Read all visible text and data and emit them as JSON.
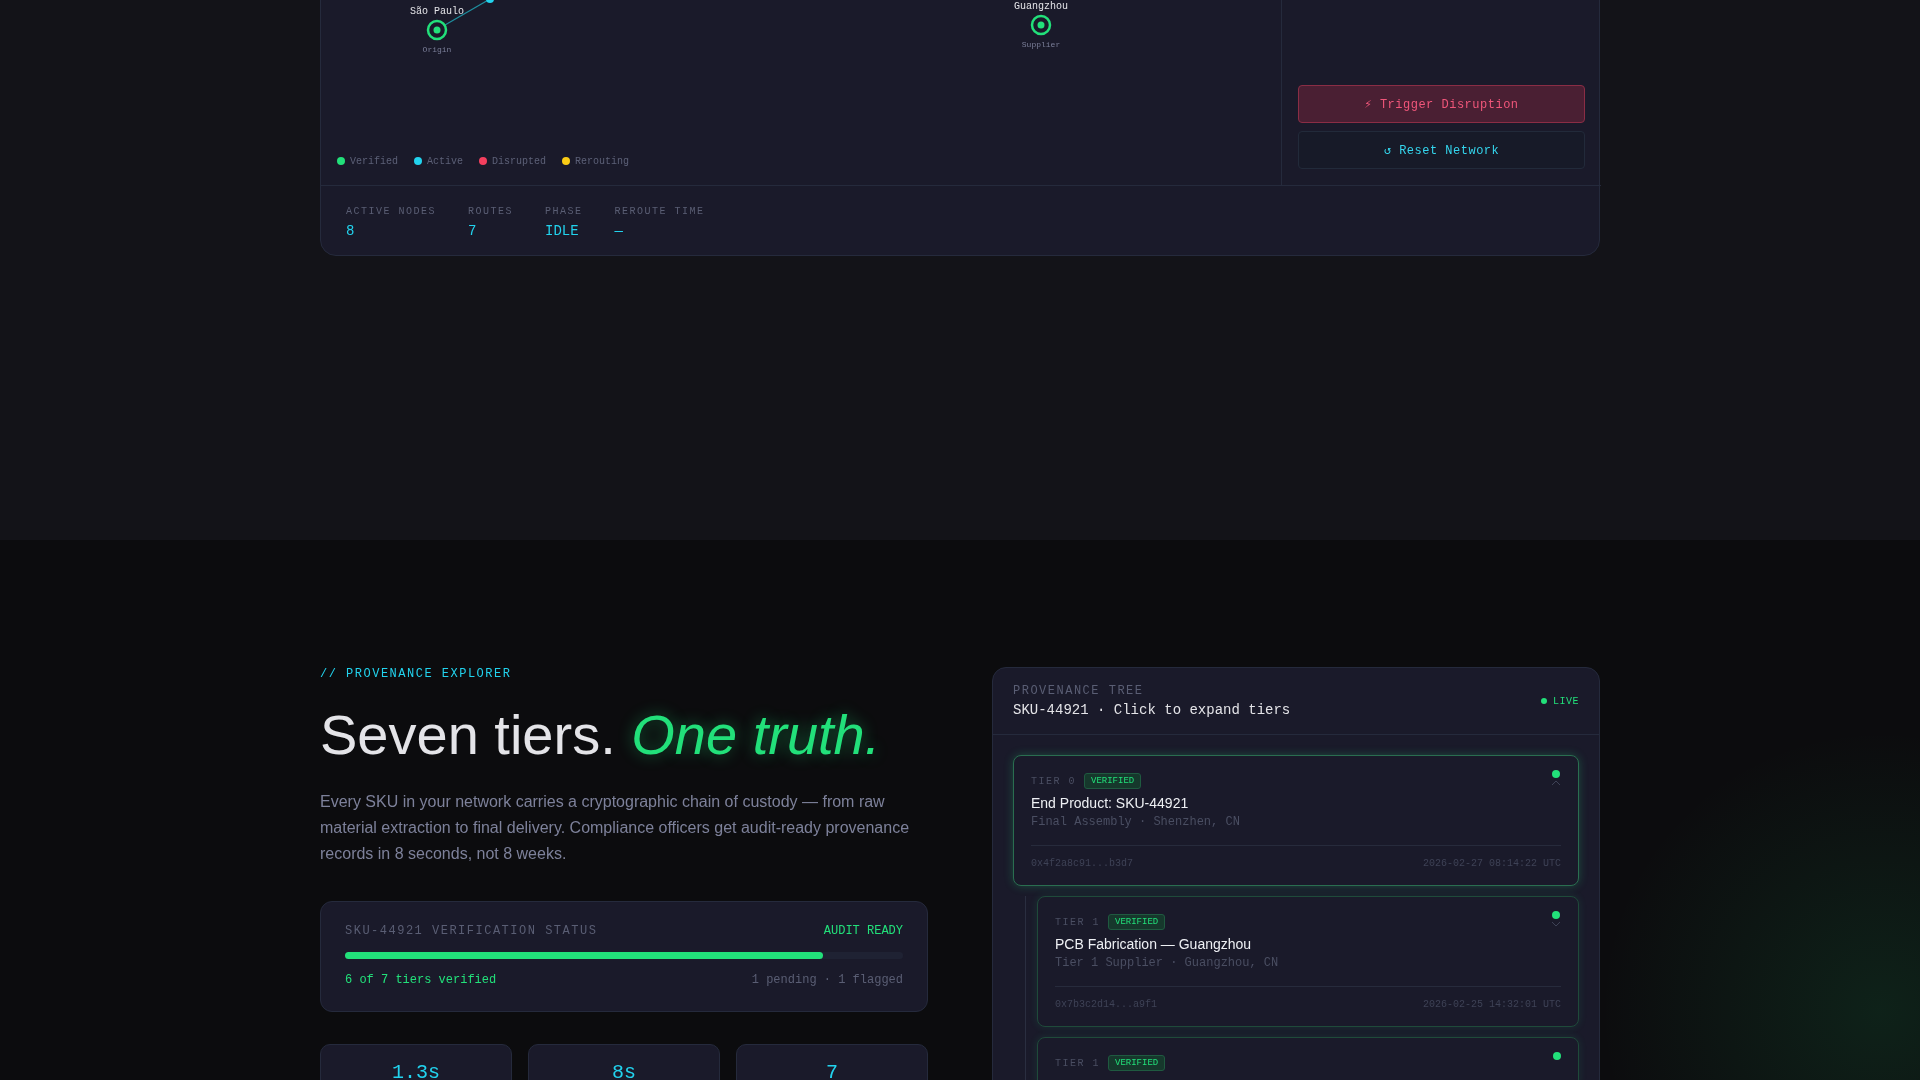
{
  "network": {
    "nodes": [
      {
        "name": "São Paulo",
        "role": "Origin",
        "color": "#22e07a"
      },
      {
        "color": "#22d3ee"
      },
      {
        "name": "Guangzhou",
        "role": "Supplier",
        "color": "#22e07a"
      }
    ],
    "legend": [
      {
        "label": "Verified",
        "color": "#22e07a"
      },
      {
        "label": "Active",
        "color": "#22d3ee"
      },
      {
        "label": "Disrupted",
        "color": "#f43f5e"
      },
      {
        "label": "Rerouting",
        "color": "#facc15"
      }
    ],
    "actions": [
      {
        "kind": "danger",
        "icon": "⚡",
        "label": "Trigger Disruption"
      },
      {
        "kind": "reset",
        "icon": "↺",
        "label": "Reset Network"
      }
    ],
    "stats": [
      {
        "label": "ACTIVE NODES",
        "value": "8"
      },
      {
        "label": "ROUTES",
        "value": "7"
      },
      {
        "label": "PHASE",
        "value": "IDLE"
      },
      {
        "label": "REROUTE TIME",
        "value": "—"
      }
    ]
  },
  "explorer": {
    "eyebrow": "// PROVENANCE EXPLORER",
    "heading": "Seven tiers.",
    "heading_accent": "One truth.",
    "description": "Every SKU in your network carries a cryptographic chain of custody — from raw material extraction to final delivery. Compliance officers get audit-ready provenance records in 8 seconds, not 8 weeks.",
    "status_card": {
      "title": "SKU-44921 VERIFICATION STATUS",
      "badge": "AUDIT READY",
      "level": 0.857,
      "progress_text": "6 of 7 tiers verified",
      "summary": "1 pending · 1 flagged"
    },
    "metrics": [
      {
        "value": "1.3s"
      },
      {
        "value": "8s"
      },
      {
        "value": "7"
      }
    ]
  },
  "tree": {
    "label": "PROVENANCE TREE",
    "subtitle": "SKU-44921 · Click to expand tiers",
    "live": "LIVE",
    "tiers": [
      {
        "tier": "TIER 0",
        "badge": "VERIFIED",
        "title": "End Product: SKU-44921",
        "subtitle": "Final Assembly · Shenzhen, CN",
        "hash": "0x4f2a8c91...b3d7",
        "timestamp": "2026-02-27 08:14:22 UTC",
        "expanded": true,
        "children": [
          {
            "tier": "TIER 1",
            "badge": "VERIFIED",
            "title": "PCB Fabrication — Guangzhou",
            "subtitle": "Tier 1 Supplier · Guangzhou, CN",
            "hash": "0x7b3c2d14...a9f1",
            "timestamp": "2026-02-25 14:32:01 UTC",
            "expanded": false
          },
          {
            "tier": "TIER 1",
            "badge": "VERIFIED",
            "expanded": false
          }
        ]
      }
    ]
  }
}
